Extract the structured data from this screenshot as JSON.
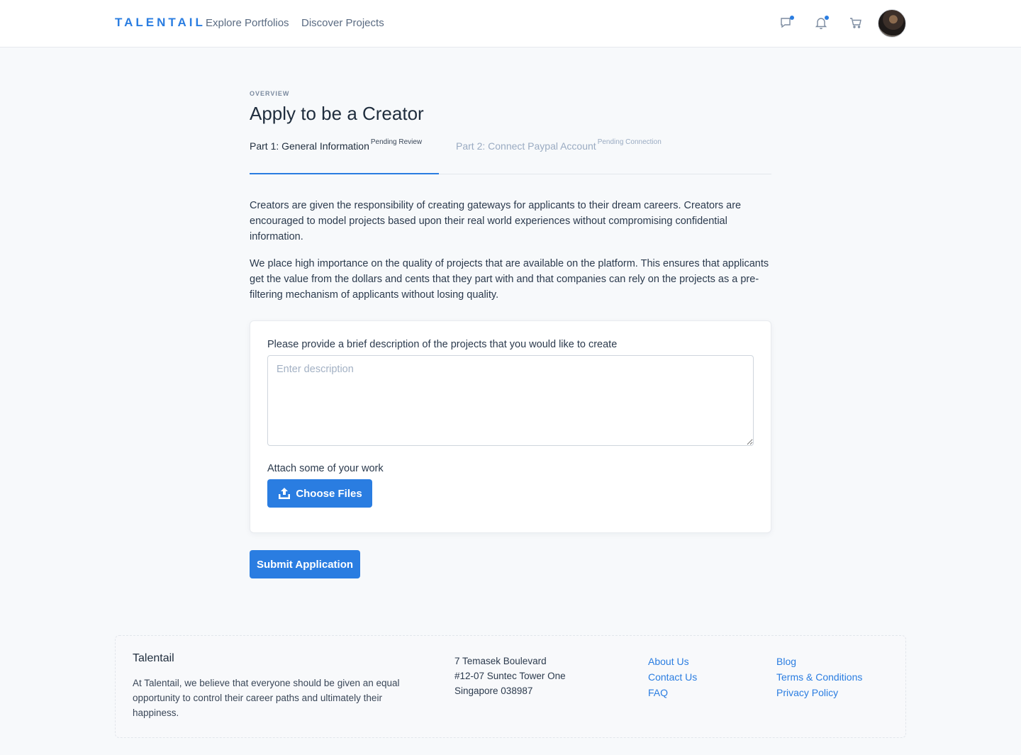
{
  "header": {
    "brand": "TALENTAIL",
    "nav": [
      "Explore Portfolios",
      "Discover Projects"
    ],
    "icons": [
      "chat-icon",
      "bell-icon",
      "cart-icon"
    ],
    "accent": "#2a7de1"
  },
  "main": {
    "overline": "OVERVIEW",
    "title": "Apply to be a Creator",
    "tabs": [
      {
        "label": "Part 1: General Information",
        "status": "Pending Review",
        "active": true
      },
      {
        "label": "Part 2: Connect Paypal Account",
        "status": "Pending Connection",
        "active": false
      }
    ],
    "paragraphs": [
      "Creators are given the responsibility of creating gateways for applicants to their dream careers. Creators are encouraged to model projects based upon their real world experiences without compromising confidential information.",
      "We place high importance on the quality of projects that are available on the platform. This ensures that applicants get the value from the dollars and cents that they part with and that companies can rely on the projects as a pre-filtering mechanism of applicants without losing quality."
    ],
    "form": {
      "description_label": "Please provide a brief description of the projects that you would like to create",
      "description_placeholder": "Enter description",
      "description_value": "",
      "attach_label": "Attach some of your work",
      "choose_files": "Choose Files"
    },
    "submit": "Submit Application"
  },
  "footer": {
    "title": "Talentail",
    "description": "At Talentail, we believe that everyone should be given an equal opportunity to control their career paths and ultimately their happiness.",
    "address": [
      "7 Temasek Boulevard",
      "#12-07 Suntec Tower One",
      "Singapore 038987"
    ],
    "links_col1": [
      "About Us",
      "Contact Us",
      "FAQ"
    ],
    "links_col2": [
      "Blog",
      "Terms & Conditions",
      "Privacy Policy"
    ]
  }
}
